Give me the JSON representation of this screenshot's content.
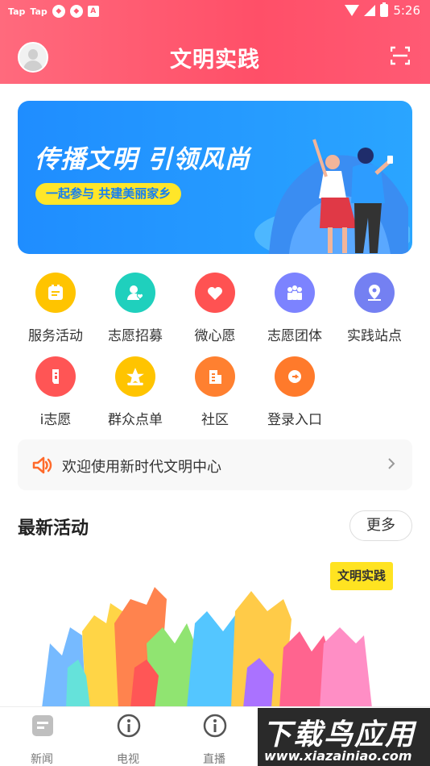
{
  "status_bar": {
    "left_items": [
      "Tap",
      "Tap",
      "A"
    ],
    "time": "5:26"
  },
  "header": {
    "title": "文明实践",
    "avatar_icon": "user-avatar-icon",
    "scan_icon": "scan-icon",
    "background_color": "#ff5a70"
  },
  "banner": {
    "headline": "传播文明 引领风尚",
    "slogan": "一起参与 共建美丽家乡",
    "background_color": "#2196ff",
    "slogan_color": "#ffe629"
  },
  "grid": {
    "items": [
      {
        "label": "服务活动",
        "icon": "calendar-icon",
        "color": "#ffc400"
      },
      {
        "label": "志愿招募",
        "icon": "user-heart-icon",
        "color": "#1fd0bd"
      },
      {
        "label": "微心愿",
        "icon": "heart-icon",
        "color": "#ff5252"
      },
      {
        "label": "志愿团体",
        "icon": "group-icon",
        "color": "#7c83ff"
      },
      {
        "label": "实践站点",
        "icon": "location-icon",
        "color": "#7480f2"
      },
      {
        "label": "i志愿",
        "icon": "volunteer-hand-icon",
        "color": "#ff5555"
      },
      {
        "label": "群众点单",
        "icon": "star-icon",
        "color": "#ffc400"
      },
      {
        "label": "社区",
        "icon": "building-icon",
        "color": "#ff8030"
      },
      {
        "label": "登录入口",
        "icon": "login-icon",
        "color": "#ff7a2b"
      }
    ]
  },
  "notice": {
    "text": "欢迎使用新时代文明中心",
    "icon": "speaker-icon"
  },
  "latest": {
    "title": "最新活动",
    "more_label": "更多",
    "tag": "文明实践"
  },
  "tabbar": {
    "tabs": [
      {
        "label": "新闻",
        "icon": "news-icon"
      },
      {
        "label": "电视",
        "icon": "info-icon"
      },
      {
        "label": "直播",
        "icon": "info-icon"
      }
    ]
  },
  "watermark": {
    "line1": "下载鸟应用",
    "line2": "www.xiazainiao.com"
  }
}
